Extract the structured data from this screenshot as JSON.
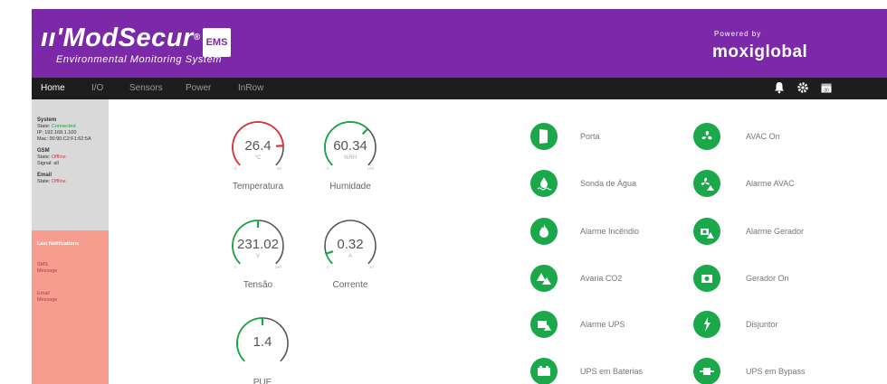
{
  "header": {
    "logo_text": "ModSecur",
    "logo_badge": "EMS",
    "subtitle": "Environmental Monitoring System",
    "powered_by": "Powered by",
    "brand": "moxiglobal",
    "bg_color": "#7b29a8"
  },
  "nav": {
    "items": [
      {
        "label": "Home",
        "active": true
      },
      {
        "label": "I/O",
        "active": false
      },
      {
        "label": "Sensors",
        "active": false
      },
      {
        "label": "Power",
        "active": false
      },
      {
        "label": "InRow",
        "active": false
      }
    ],
    "icons": [
      {
        "icon": "bell-icon",
        "glyph": "🔔"
      },
      {
        "icon": "gear-icon",
        "glyph": "⚙"
      },
      {
        "icon": "calendar-icon",
        "glyph": "30"
      }
    ]
  },
  "sidebar": {
    "system": {
      "title": "System",
      "state_label": "State:",
      "state": "Connected",
      "ip": "IP: 192.168.1.100",
      "mac": "Mac: 00:90:C2:F1:62:5A"
    },
    "gsm": {
      "title": "GSM",
      "state_label": "State:",
      "state": "Offline",
      "signal": "Signal: all"
    },
    "email": {
      "title": "Email",
      "state_label": "State:",
      "state": "Offline"
    },
    "notifications": {
      "title": "Last Notifications",
      "items": [
        {
          "line1": "SMS",
          "line2": "Message"
        },
        {
          "line1": "Email",
          "line2": "Message"
        }
      ]
    }
  },
  "gauges": [
    {
      "id": "temp",
      "value": "26.4",
      "unit": "°C",
      "min": "0",
      "max": "50",
      "label": "Temperatura",
      "fraction": 0.82,
      "color": "#e0303a"
    },
    {
      "id": "hum",
      "value": "60.34",
      "unit": "%RH",
      "min": "0",
      "max": "100",
      "label": "Humidade",
      "fraction": 0.66,
      "color": "#1aa84a"
    },
    {
      "id": "volt",
      "value": "231.02",
      "unit": "V",
      "min": "0",
      "max": "260",
      "label": "Tensão",
      "fraction": 0.5,
      "color": "#1aa84a"
    },
    {
      "id": "curr",
      "value": "0.32",
      "unit": "A",
      "min": "0",
      "max": "10",
      "label": "Corrente",
      "fraction": 0.1,
      "color": "#1aa84a"
    },
    {
      "id": "pue",
      "value": "1.4",
      "unit": "",
      "min": "",
      "max": "",
      "label": "PUE",
      "fraction": 0.5,
      "color": "#1aa84a"
    }
  ],
  "statuses": [
    {
      "label": "Porta",
      "icon": "door-icon"
    },
    {
      "label": "AVAC On",
      "icon": "fan-icon"
    },
    {
      "label": "Sonda de Água",
      "icon": "water-drop-icon"
    },
    {
      "label": "Alarme AVAC",
      "icon": "fan-alarm-icon"
    },
    {
      "label": "Alarme Incêndio",
      "icon": "fire-icon"
    },
    {
      "label": "Alarme Gerador",
      "icon": "generator-alarm-icon"
    },
    {
      "label": "Avaria CO2",
      "icon": "co2-alarm-icon"
    },
    {
      "label": "Gerador On",
      "icon": "generator-icon"
    },
    {
      "label": "Alarme UPS",
      "icon": "ups-alarm-icon"
    },
    {
      "label": "Disjuntor",
      "icon": "breaker-icon"
    },
    {
      "label": "UPS em Baterias",
      "icon": "battery-icon"
    },
    {
      "label": "UPS em Bypass",
      "icon": "bypass-icon"
    }
  ],
  "colors": {
    "ok": "#1aa84a",
    "alarm": "#e0303a",
    "nav_bg": "#1d1d1d"
  }
}
